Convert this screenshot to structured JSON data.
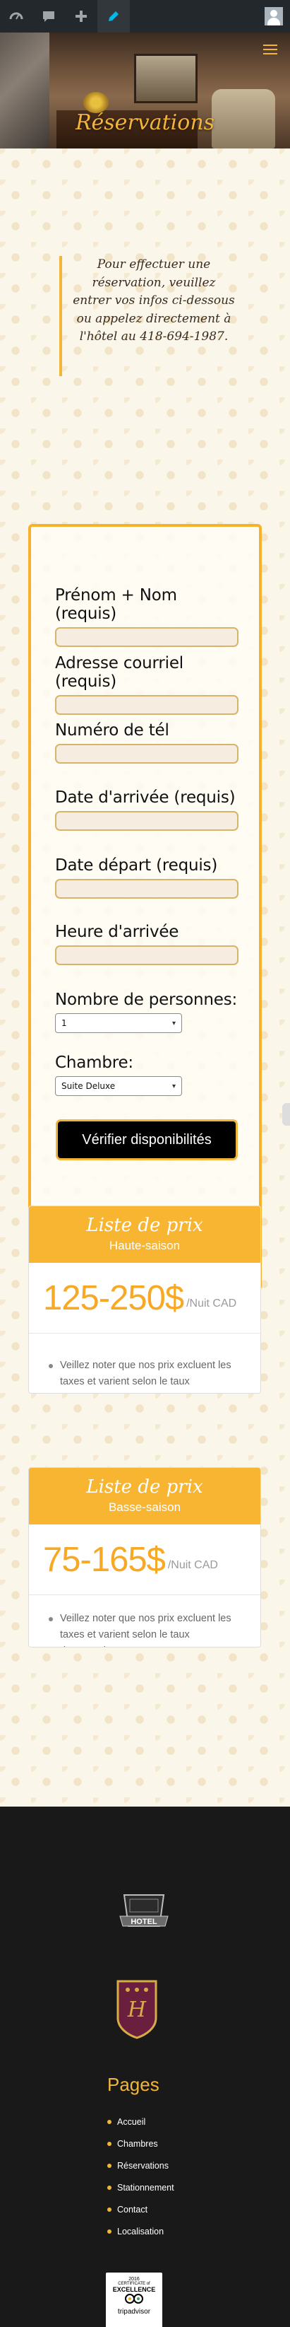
{
  "adminbar": {
    "icons": [
      "dashboard-icon",
      "comment-icon",
      "plus-icon",
      "pencil-icon",
      "avatar-icon"
    ]
  },
  "header": {
    "title": "Réservations",
    "menu_icon": "hamburger-icon"
  },
  "intro": {
    "text": "Pour effectuer une réservation, veuillez entrer vos infos ci-dessous ou appelez directement à l'hôtel au 418-694-1987."
  },
  "form": {
    "fields": [
      {
        "label": "Prénom + Nom (requis)",
        "value": "",
        "placeholder": ""
      },
      {
        "label": "Adresse courriel (requis)",
        "value": "",
        "placeholder": ""
      },
      {
        "label": "Numéro de tél",
        "value": "",
        "placeholder": ""
      },
      {
        "label": "Date d'arrivée (requis)",
        "value": "",
        "placeholder": ""
      },
      {
        "label": "Date départ (requis)",
        "value": "",
        "placeholder": ""
      },
      {
        "label": "Heure d'arrivée",
        "value": "",
        "placeholder": ""
      }
    ],
    "persons": {
      "label": "Nombre de personnes:",
      "selected": "1"
    },
    "room": {
      "label": "Chambre:",
      "selected": "Suite Deluxe"
    },
    "submit_label": "Vérifier disponibilités"
  },
  "prices": [
    {
      "title": "Liste de prix",
      "season": "Haute-saison",
      "amount": "125-250$",
      "unit": "/Nuit CAD",
      "note": "Veillez noter que nos prix excluent les taxes et varient selon le taux d'occupation."
    },
    {
      "title": "Liste de prix",
      "season": "Basse-saison",
      "amount": "75-165$",
      "unit": "/Nuit CAD",
      "note": "Veillez noter que nos prix excluent les taxes et varient selon le taux d'occupation."
    }
  ],
  "footer": {
    "hotel_logo_text": "HOTEL",
    "pages_title": "Pages",
    "pages": [
      "Accueil",
      "Chambres",
      "Réservations",
      "Stationnement",
      "Contact",
      "Localisation"
    ],
    "tripadvisor": {
      "line1": "2016",
      "line2": "CERTIFICATE of",
      "line3": "EXCELLENCE",
      "brand": "tripadvisor"
    }
  },
  "colors": {
    "accent": "#f3b43a",
    "price": "#f7a824",
    "footer_bg": "#191919"
  }
}
